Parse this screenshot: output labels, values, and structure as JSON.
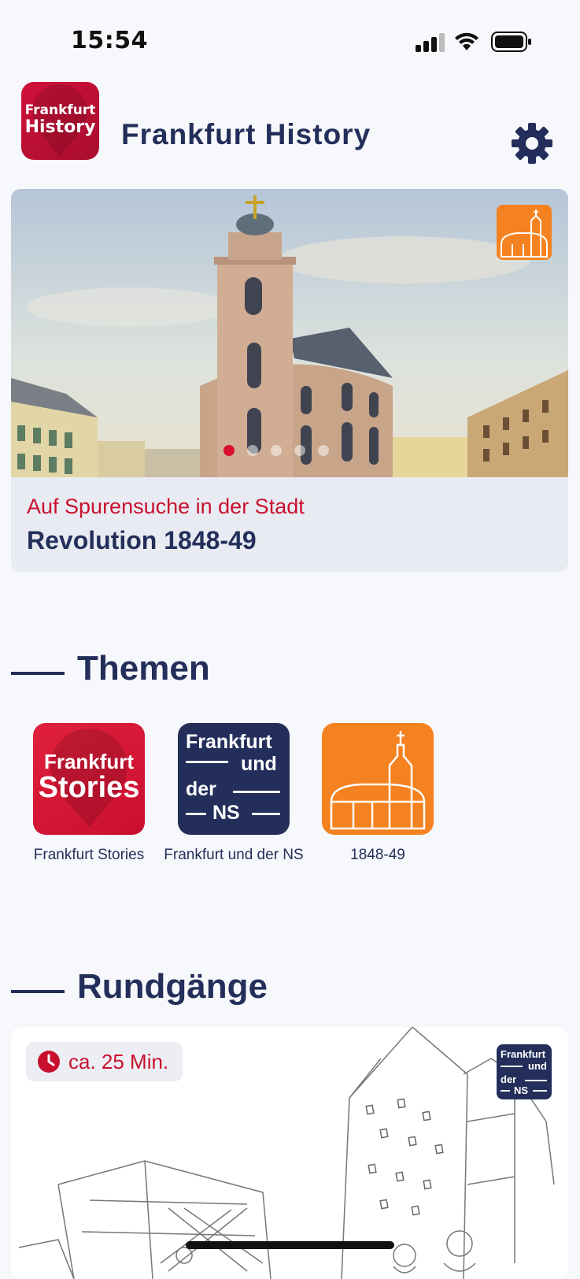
{
  "status_bar": {
    "time": "15:54"
  },
  "header": {
    "logo_line1": "Frankfurt",
    "logo_line2": "History",
    "title": "Frankfurt History"
  },
  "hero": {
    "subtitle": "Auf Spurensuche in der Stadt",
    "title": "Revolution 1848-49",
    "carousel_pages": 5,
    "carousel_active": 1
  },
  "themen": {
    "heading": "Themen",
    "tiles": [
      {
        "label": "Frankfurt Stories",
        "logo_line1": "Frankfurt",
        "logo_line2": "Stories"
      },
      {
        "label": "Frankfurt und der NS",
        "logo_line1": "Frankfurt",
        "logo_line2": "und",
        "logo_line3": "der",
        "logo_line4": "NS"
      },
      {
        "label": "1848-49"
      }
    ]
  },
  "rundgaenge": {
    "heading": "Rundgänge",
    "card": {
      "duration": "ca. 25 Min.",
      "badge_line1": "Frankfurt",
      "badge_line2": "und",
      "badge_line3": "der",
      "badge_line4": "NS"
    }
  },
  "colors": {
    "navy": "#232f5a",
    "red": "#c8102e",
    "orange": "#f58220",
    "background": "#f7f8fb"
  },
  "icons": [
    "cellular-signal-icon",
    "wifi-icon",
    "battery-icon",
    "gear-icon",
    "clock-icon",
    "church-icon"
  ]
}
